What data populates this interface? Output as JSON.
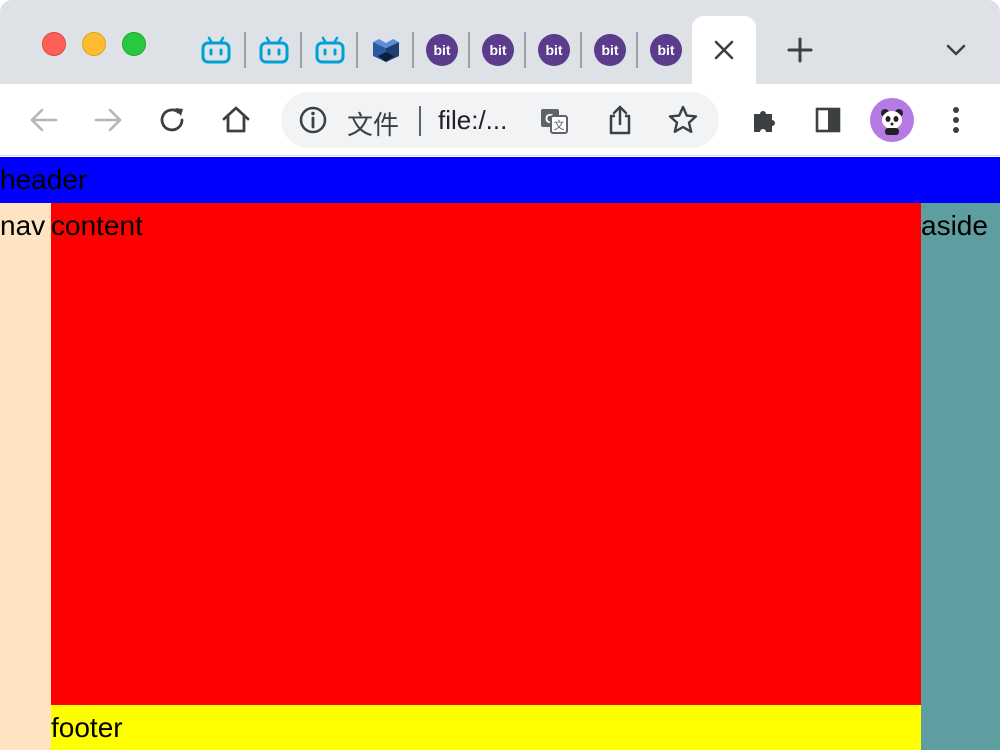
{
  "window": {
    "tabs": [
      {
        "favicon": "bilibili-icon"
      },
      {
        "favicon": "bilibili-icon"
      },
      {
        "favicon": "bilibili-icon"
      },
      {
        "favicon": "book-icon"
      },
      {
        "favicon": "bit-icon",
        "text": "bit"
      },
      {
        "favicon": "bit-icon",
        "text": "bit"
      },
      {
        "favicon": "bit-icon",
        "text": "bit"
      },
      {
        "favicon": "bit-icon",
        "text": "bit"
      },
      {
        "favicon": "bit-icon",
        "text": "bit"
      }
    ],
    "active_tab_close": "✕",
    "new_tab": "+"
  },
  "toolbar": {
    "address_label": "文件",
    "address_url": "file:/..."
  },
  "page": {
    "header": "header",
    "nav": "nav",
    "content": "content",
    "aside": "aside",
    "footer": "footer"
  },
  "colors": {
    "header": "#0000ff",
    "nav": "#ffe4c4",
    "content": "#ff0000",
    "aside": "#5f9ea0",
    "footer": "#ffff00"
  }
}
